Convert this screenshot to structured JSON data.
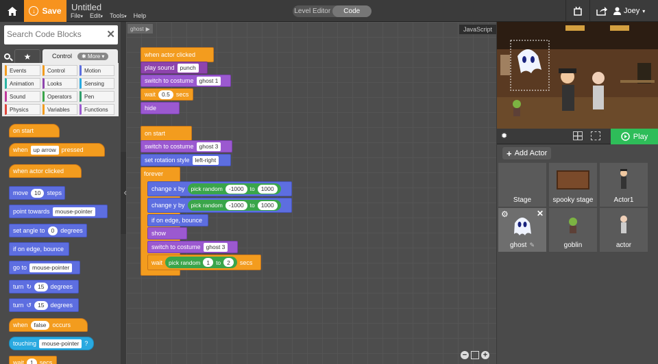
{
  "topbar": {
    "save_label": "Save",
    "project_title": "Untitled",
    "menus": [
      "File",
      "Edit",
      "Tools",
      "Help"
    ],
    "mode_tabs": [
      "Level Editor",
      "Code"
    ],
    "active_mode": "Code",
    "user_name": "Joey"
  },
  "palette": {
    "search_placeholder": "Search Code Blocks",
    "tab_control": "Control",
    "more_label": "More",
    "categories": [
      {
        "label": "Events",
        "color": "#f39c1e"
      },
      {
        "label": "Control",
        "color": "#f39c1e"
      },
      {
        "label": "Motion",
        "color": "#5d6ee0"
      },
      {
        "label": "Animation",
        "color": "#2bb3a3"
      },
      {
        "label": "Looks",
        "color": "#8e44ad"
      },
      {
        "label": "Sensing",
        "color": "#29a9e0"
      },
      {
        "label": "Sound",
        "color": "#c0399b"
      },
      {
        "label": "Operators",
        "color": "#3aa54a"
      },
      {
        "label": "Pen",
        "color": "#2f9e6b"
      },
      {
        "label": "Physics",
        "color": "#e0453a"
      },
      {
        "label": "Variables",
        "color": "#f39c1e"
      },
      {
        "label": "Functions",
        "color": "#9b59d0"
      }
    ],
    "blocks": {
      "on_start": "on start",
      "when": "when",
      "up_arrow": "up arrow",
      "pressed": "pressed",
      "when_actor_clicked": "when actor clicked",
      "move": "move",
      "move_val": "10",
      "steps": "steps",
      "point_towards": "point towards",
      "mouse_pointer": "mouse-pointer",
      "set_angle_to": "set angle to",
      "angle_val": "0",
      "degrees": "degrees",
      "if_on_edge": "if on edge, bounce",
      "go_to": "go to",
      "turn": "turn",
      "turn_val": "15",
      "when2": "when",
      "false_val": "false",
      "occurs": "occurs",
      "touching": "touching",
      "wait": "wait",
      "wait_val": "1",
      "secs": "secs"
    }
  },
  "code": {
    "breadcrumb": "ghost",
    "js_label": "JavaScript",
    "script1": {
      "hat": "when actor clicked",
      "play_sound": "play sound",
      "sound_val": "punch",
      "switch_costume": "switch to costume",
      "costume1": "ghost 1",
      "wait": "wait",
      "wait_val": "0.5",
      "secs": "secs",
      "hide": "hide"
    },
    "script2": {
      "hat": "on start",
      "switch_costume": "switch to costume",
      "costume": "ghost 3",
      "set_rotation": "set rotation style",
      "rotation_val": "left-right",
      "forever": "forever",
      "change_x": "change x by",
      "change_y": "change y by",
      "pick_random": "pick random",
      "min": "-1000",
      "to": "to",
      "max": "1000",
      "if_on_edge": "if on edge, bounce",
      "show": "show",
      "switch_costume2": "switch to costume",
      "costume2": "ghost 3",
      "wait": "wait",
      "rand_min": "1",
      "rand_max": "2",
      "secs": "secs"
    }
  },
  "stage": {
    "play_label": "Play"
  },
  "actors": {
    "add_label": "Add Actor",
    "tiles": [
      "Stage",
      "spooky stage",
      "Actor1",
      "ghost",
      "goblin",
      "actor"
    ]
  }
}
